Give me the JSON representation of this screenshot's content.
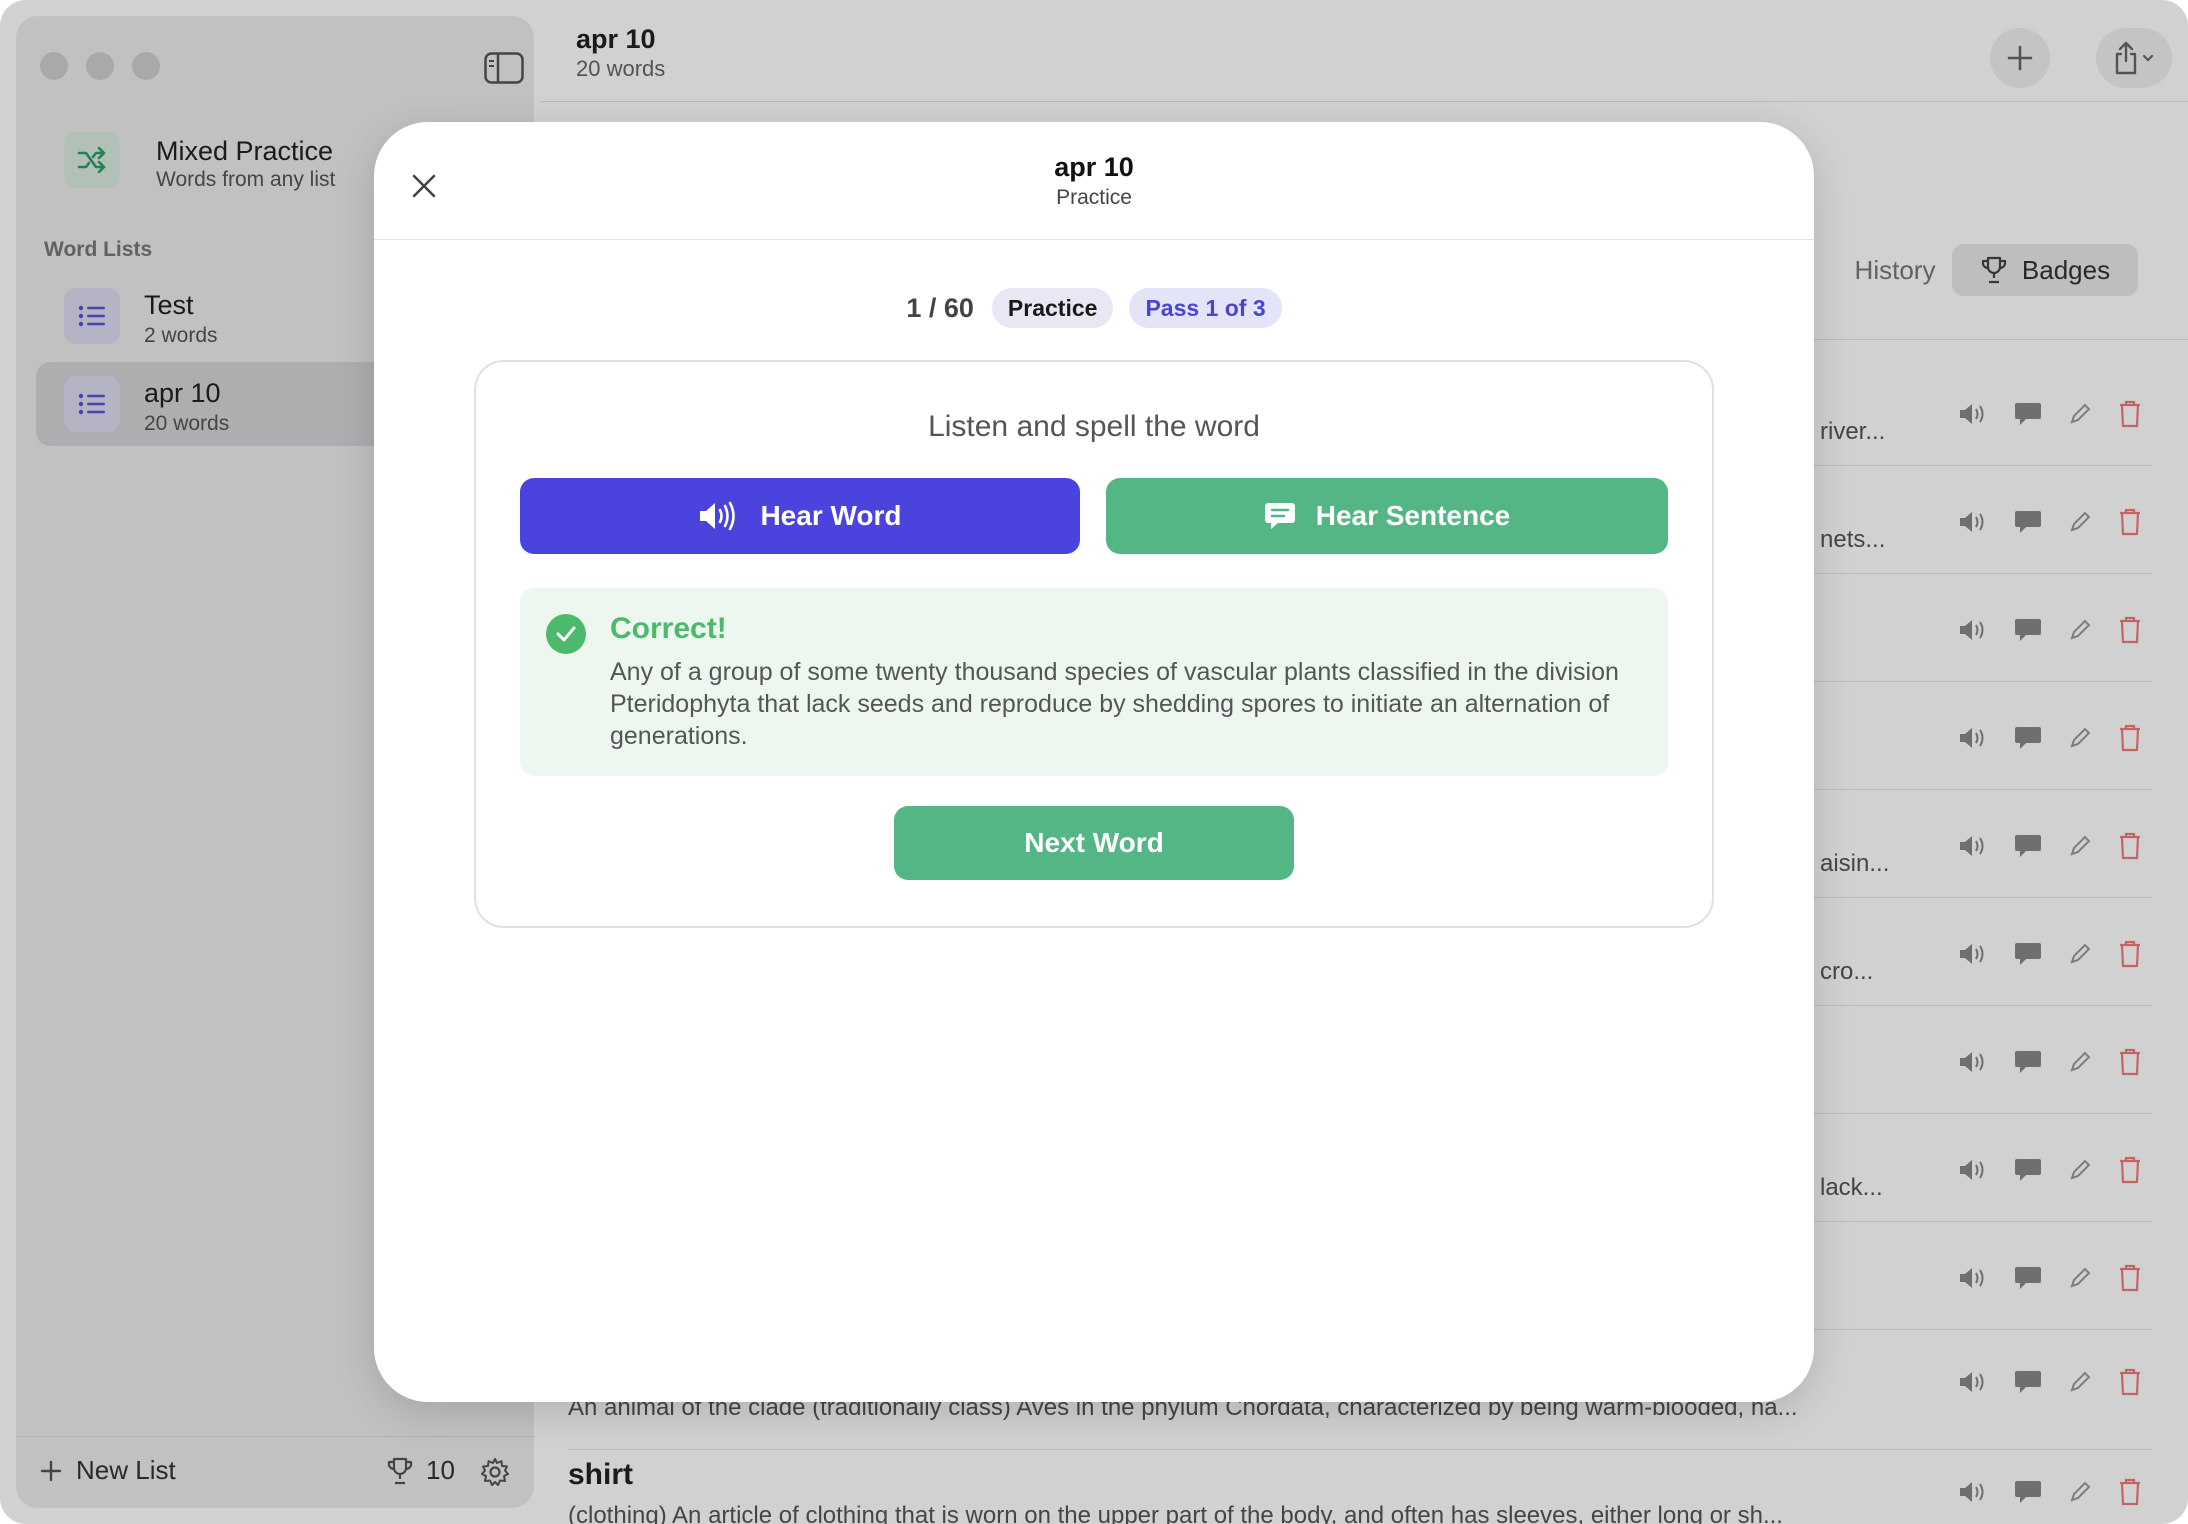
{
  "sidebar": {
    "mixed": {
      "title": "Mixed Practice",
      "subtitle": "Words from any list"
    },
    "section_label": "Word Lists",
    "lists": [
      {
        "title": "Test",
        "subtitle": "2 words"
      },
      {
        "title": "apr 10",
        "subtitle": "20 words"
      }
    ],
    "footer": {
      "new_list_label": "New List",
      "trophy_count": "10"
    }
  },
  "main": {
    "title": "apr 10",
    "subtitle": "20 words",
    "segments": {
      "history": "History",
      "badges": "Badges"
    },
    "rows": [
      {
        "preview": "river..."
      },
      {
        "preview": "nets..."
      },
      {
        "preview": ""
      },
      {
        "preview": ""
      },
      {
        "preview": "aisin..."
      },
      {
        "preview": "cro..."
      },
      {
        "preview": ""
      },
      {
        "preview": "lack..."
      },
      {
        "preview": ""
      }
    ],
    "bird_def": "An animal of the clade (traditionally class) Aves in the phylum Chordata, characterized by being warm-blooded, ha...",
    "shirt": {
      "word": "shirt",
      "def": "(clothing) An article of clothing that is worn on the upper part of the body, and often has sleeves, either long or sh..."
    }
  },
  "modal": {
    "title": "apr 10",
    "subtitle": "Practice",
    "progress": "1 / 60",
    "mode_pill": "Practice",
    "pass_pill": "Pass 1 of 3",
    "prompt": "Listen and spell the word",
    "hear_word": "Hear Word",
    "hear_sentence": "Hear Sentence",
    "result_title": "Correct!",
    "result_def": "Any of a group of some twenty thousand species of vascular plants classified in the division Pteridophyta that lack seeds and reproduce by shedding spores to initiate an alternation of generations.",
    "next_label": "Next Word"
  },
  "colors": {
    "accent_indigo": "#4b43de",
    "accent_green": "#54b684",
    "success": "#4cba6b"
  }
}
